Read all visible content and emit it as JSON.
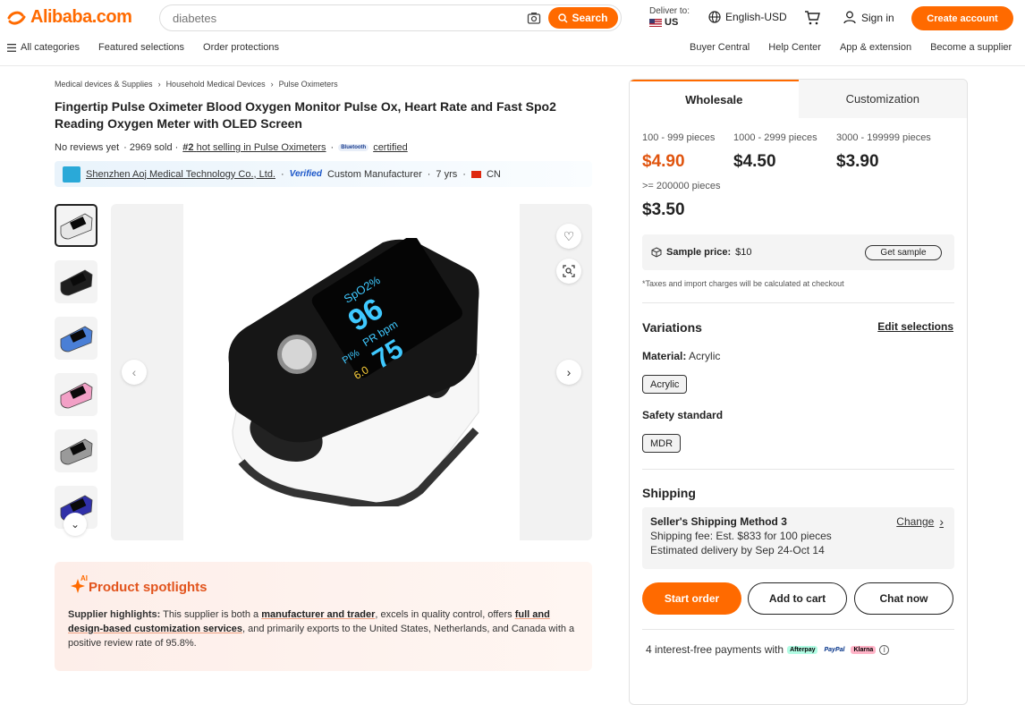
{
  "header": {
    "logo_text": "Alibaba.com",
    "search_placeholder": "diabetes",
    "search_button": "Search",
    "deliver_label": "Deliver to:",
    "deliver_country": "US",
    "language": "English-USD",
    "sign_in": "Sign in",
    "create_account": "Create account"
  },
  "nav": {
    "left": [
      "All categories",
      "Featured selections",
      "Order protections"
    ],
    "right": [
      "Buyer Central",
      "Help Center",
      "App & extension",
      "Become a supplier"
    ]
  },
  "breadcrumb": [
    "Medical devices & Supplies",
    "Household Medical Devices",
    "Pulse Oximeters"
  ],
  "product": {
    "title": "Fingertip Pulse Oximeter Blood Oxygen Monitor Pulse Ox, Heart Rate and Fast Spo2 Reading Oxygen Meter with OLED Screen",
    "reviews": "No reviews yet",
    "sold": "· 2969 sold ·",
    "rank_num": "#2",
    "rank_text": "hot selling in Pulse Oximeters",
    "bluetooth_badge": "Bluetooth",
    "certified": "certified"
  },
  "supplier": {
    "name": "Shenzhen Aoj Medical Technology Co., Ltd.",
    "verified": "Verified",
    "type": "Custom Manufacturer",
    "years": "7 yrs",
    "country": "CN"
  },
  "gallery": {
    "thumb_colors": [
      "#e6e6e6",
      "#1e1e1e",
      "#4a7fd6",
      "#f2a0c6",
      "#9a9a9a",
      "#3030a8"
    ],
    "screen_spo2_label": "SpO2%",
    "screen_spo2": "96",
    "screen_pr_label": "PR bpm",
    "screen_pr": "75",
    "screen_pi_label": "PI%",
    "screen_pi": "6.0"
  },
  "spotlight": {
    "title": "Product spotlights",
    "ai_badge": "AI",
    "lead": "Supplier highlights:",
    "t1": " This supplier is both a ",
    "h1": "manufacturer and trader",
    "t2": ", excels in quality control, offers ",
    "h2": "full and design-based customization services",
    "t3": ", and primarily exports to the United States, Netherlands, and Canada with a positive review rate of 95.8%."
  },
  "panel": {
    "tabs": [
      "Wholesale",
      "Customization"
    ],
    "tiers": [
      {
        "range": "100 - 999 pieces",
        "price": "$4.90"
      },
      {
        "range": "1000 - 2999 pieces",
        "price": "$4.50"
      },
      {
        "range": "3000 - 199999 pieces",
        "price": "$3.90"
      },
      {
        "range": ">= 200000 pieces",
        "price": "$3.50"
      }
    ],
    "sample_label": "Sample price:",
    "sample_price": "$10",
    "get_sample": "Get sample",
    "tax_note": "*Taxes and import charges will be calculated at checkout",
    "variations_title": "Variations",
    "edit_selections": "Edit selections",
    "material_label": "Material:",
    "material_value": "Acrylic",
    "material_chip": "Acrylic",
    "safety_label": "Safety standard",
    "safety_chip": "MDR",
    "shipping_title": "Shipping",
    "ship_method": "Seller's Shipping Method 3",
    "change": "Change",
    "ship_fee": "Shipping fee: Est. $833 for 100 pieces",
    "ship_delivery": "Estimated delivery by Sep 24-Oct 14",
    "start_order": "Start order",
    "add_to_cart": "Add to cart",
    "chat_now": "Chat now",
    "payments": "4 interest-free payments with",
    "pay_brands": [
      "Afterpay",
      "PayPal",
      "Klarna"
    ]
  },
  "colors": {
    "accent": "#ff6a00",
    "price_highlight": "#e0540e"
  }
}
